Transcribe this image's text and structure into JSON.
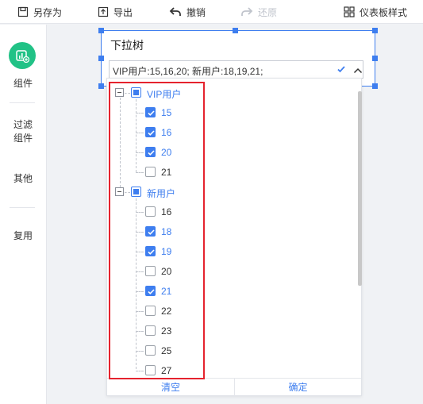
{
  "toolbar": {
    "save_as": "另存为",
    "export": "导出",
    "undo": "撤销",
    "redo": "还原",
    "dashboard_style": "仪表板样式"
  },
  "sidebar": {
    "items": [
      {
        "label": "组件"
      },
      {
        "label": "过滤\n组件"
      },
      {
        "label": "其他"
      },
      {
        "label": "复用"
      }
    ]
  },
  "widget": {
    "title": "下拉树",
    "selected_value": "VIP用户:15,16,20; 新用户:18,19,21;"
  },
  "tree": {
    "groups": [
      {
        "label": "VIP用户",
        "state": "partial",
        "children": [
          {
            "label": "15",
            "checked": true
          },
          {
            "label": "16",
            "checked": true
          },
          {
            "label": "20",
            "checked": true
          },
          {
            "label": "21",
            "checked": false
          }
        ]
      },
      {
        "label": "新用户",
        "state": "partial",
        "children": [
          {
            "label": "16",
            "checked": false
          },
          {
            "label": "18",
            "checked": true
          },
          {
            "label": "19",
            "checked": true
          },
          {
            "label": "20",
            "checked": false
          },
          {
            "label": "21",
            "checked": true
          },
          {
            "label": "22",
            "checked": false
          },
          {
            "label": "23",
            "checked": false
          },
          {
            "label": "25",
            "checked": false
          },
          {
            "label": "27",
            "checked": false
          }
        ]
      }
    ]
  },
  "dropdown_footer": {
    "clear": "清空",
    "confirm": "确定"
  },
  "colors": {
    "accent": "#3e7eef",
    "brand_green": "#21c286",
    "highlight_frame": "#e5232e"
  }
}
